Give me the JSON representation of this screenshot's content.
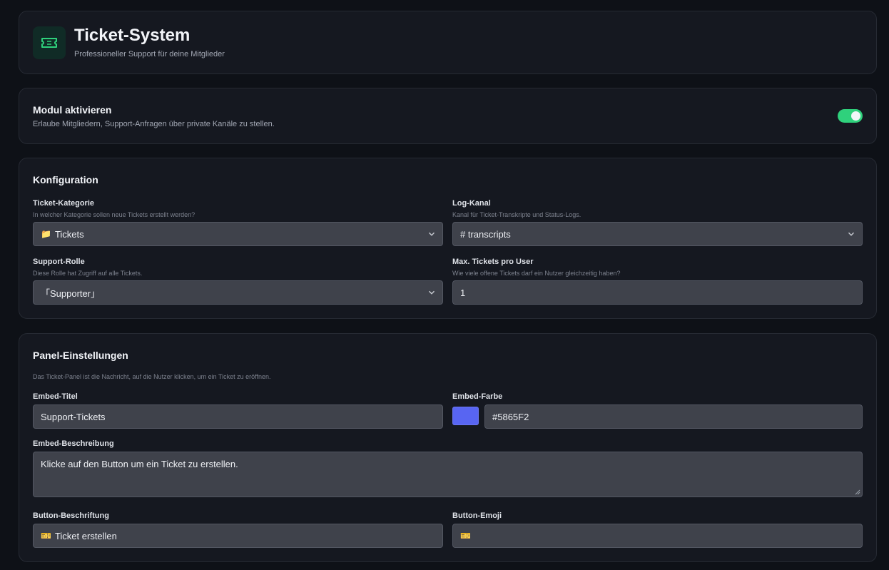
{
  "header": {
    "title": "Ticket-System",
    "subtitle": "Professioneller Support für deine Mitglieder",
    "icon": "ticket-icon",
    "accent": "#2fd17c"
  },
  "module": {
    "title": "Modul aktivieren",
    "description": "Erlaube Mitgliedern, Support-Anfragen über private Kanäle zu stellen.",
    "enabled": true
  },
  "config": {
    "title": "Konfiguration",
    "ticket_category": {
      "label": "Ticket-Kategorie",
      "hint": "In welcher Kategorie sollen neue Tickets erstellt werden?",
      "icon": "📁",
      "value": "Tickets"
    },
    "log_channel": {
      "label": "Log-Kanal",
      "hint": "Kanal für Ticket-Transkripte und Status-Logs.",
      "value": "# transcripts"
    },
    "support_role": {
      "label": "Support-Rolle",
      "hint": "Diese Rolle hat Zugriff auf alle Tickets.",
      "value": "「Supporter」"
    },
    "max_tickets": {
      "label": "Max. Tickets pro User",
      "hint": "Wie viele offene Tickets darf ein Nutzer gleichzeitig haben?",
      "value": "1"
    }
  },
  "panel": {
    "title": "Panel-Einstellungen",
    "description": "Das Ticket-Panel ist die Nachricht, auf die Nutzer klicken, um ein Ticket zu eröffnen.",
    "embed_title": {
      "label": "Embed-Titel",
      "value": "Support-Tickets"
    },
    "embed_color": {
      "label": "Embed-Farbe",
      "value": "#5865F2"
    },
    "embed_description": {
      "label": "Embed-Beschreibung",
      "value": "Klicke auf den Button um ein Ticket zu erstellen."
    },
    "button_label": {
      "label": "Button-Beschriftung",
      "icon": "🎫",
      "value": "Ticket erstellen"
    },
    "button_emoji": {
      "label": "Button-Emoji",
      "value": "🎫"
    }
  }
}
